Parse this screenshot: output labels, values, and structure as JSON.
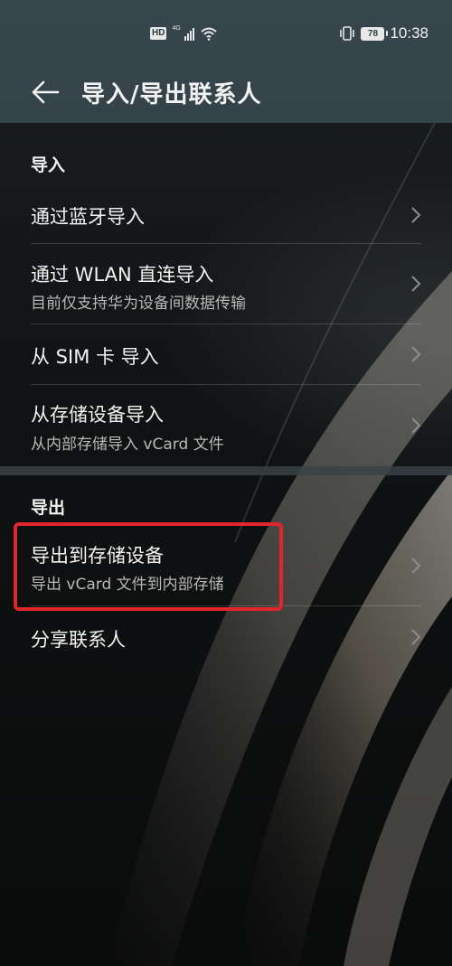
{
  "status": {
    "hd": "HD",
    "net": "4G",
    "battery": "78",
    "time": "10:38"
  },
  "header": {
    "title": "导入/导出联系人"
  },
  "import": {
    "header": "导入",
    "items": [
      {
        "label": "通过蓝牙导入"
      },
      {
        "label": "通过 WLAN 直连导入",
        "sub": "目前仅支持华为设备间数据传输"
      },
      {
        "label": "从 SIM 卡 导入"
      },
      {
        "label": "从存储设备导入",
        "sub": "从内部存储导入 vCard 文件"
      }
    ]
  },
  "export": {
    "header": "导出",
    "items": [
      {
        "label": "导出到存储设备",
        "sub": "导出 vCard 文件到内部存储"
      },
      {
        "label": "分享联系人"
      }
    ]
  },
  "colors": {
    "highlight": "#e0252c",
    "titlebar": "#35454c"
  }
}
